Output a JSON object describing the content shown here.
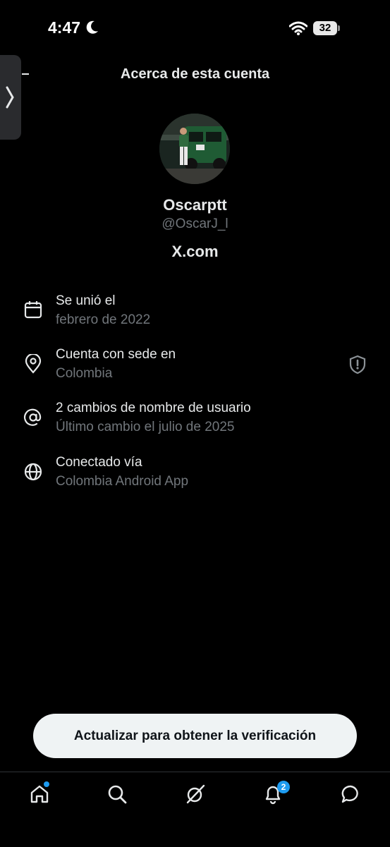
{
  "status_bar": {
    "time": "4:47",
    "battery": "32"
  },
  "header": {
    "title": "Acerca de esta cuenta"
  },
  "profile": {
    "name": "Oscarptt",
    "handle": "@OscarJ_l",
    "site": "X.com"
  },
  "rows": [
    {
      "icon": "calendar-icon",
      "title": "Se unió el",
      "subtitle": "febrero de 2022"
    },
    {
      "icon": "location-pin-icon",
      "title": "Cuenta con sede en",
      "subtitle": "Colombia"
    },
    {
      "icon": "at-sign-icon",
      "title": "2 cambios de nombre de usuario",
      "subtitle": "Último cambio el julio de 2025"
    },
    {
      "icon": "globe-icon",
      "title": "Conectado vía",
      "subtitle": "Colombia Android App"
    }
  ],
  "cta": {
    "label": "Actualizar para obtener la verificación"
  },
  "nav": {
    "items": [
      "home-icon",
      "search-icon",
      "grok-icon",
      "notifications-icon",
      "messages-icon"
    ],
    "notifications_badge": "2"
  },
  "colors": {
    "accent": "#1d9bf0",
    "secondary_text": "#71767b",
    "background": "#000000"
  }
}
